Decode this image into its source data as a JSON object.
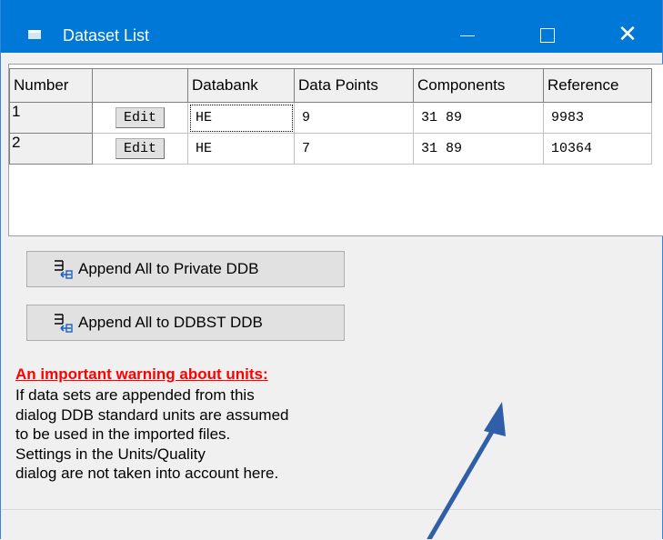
{
  "window": {
    "title": "Dataset List"
  },
  "grid": {
    "headers": [
      "Number",
      "",
      "Databank",
      "Data Points",
      "Components",
      "Reference"
    ],
    "rows": [
      {
        "number": "1",
        "edit": "Edit",
        "databank": "HE",
        "points": "9",
        "components": "31 89",
        "reference": "9983"
      },
      {
        "number": "2",
        "edit": "Edit",
        "databank": "HE",
        "points": "7",
        "components": "31 89",
        "reference": "10364"
      }
    ]
  },
  "buttons": {
    "append_private": "Append All to Private DDB",
    "append_ddbst": "Append All to DDBST DDB"
  },
  "warning": {
    "title": "An important warning about units:",
    "lines": [
      "If data sets are appended from this",
      "dialog DDB standard units are assumed",
      "to be used in the imported files.",
      "Settings in the Units/Quality",
      "dialog are not taken into account here."
    ]
  },
  "colors": {
    "titlebar": "#0078d7",
    "warning": "#ff0000",
    "arrow": "#2f5fa8"
  }
}
